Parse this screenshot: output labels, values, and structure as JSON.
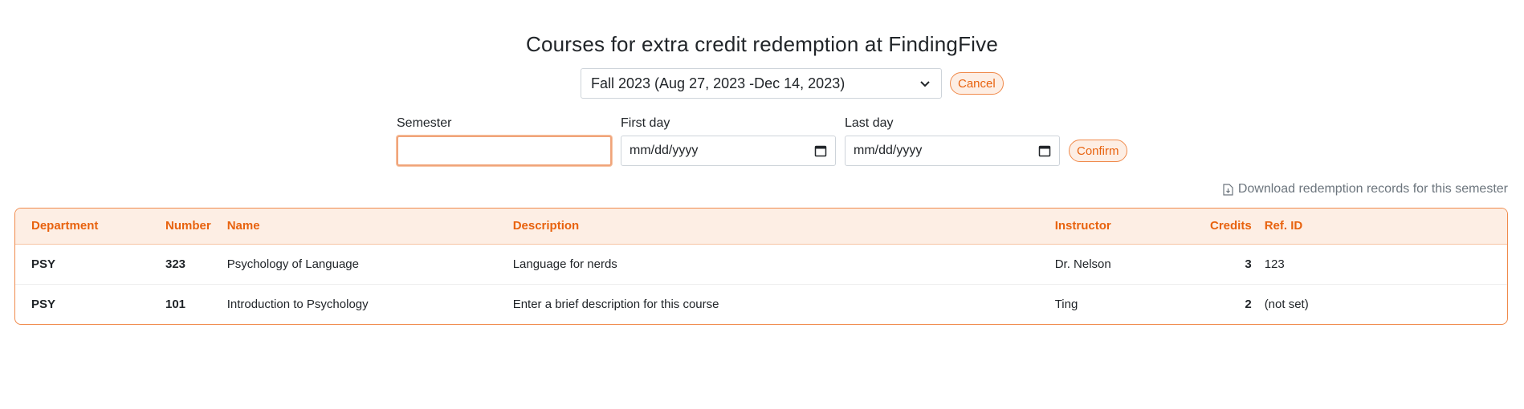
{
  "page": {
    "title": "Courses for extra credit redemption at FindingFive"
  },
  "semester_picker": {
    "selected": "Fall 2023 (Aug 27, 2023 -Dec 14, 2023)",
    "cancel_label": "Cancel"
  },
  "new_semester_form": {
    "semester_label": "Semester",
    "semester_value": "",
    "first_day_label": "First day",
    "first_day_placeholder": "mm/dd/yyyy",
    "last_day_label": "Last day",
    "last_day_placeholder": "mm/dd/yyyy",
    "confirm_label": "Confirm"
  },
  "download": {
    "label": "Download redemption records for this semester",
    "icon": "file-download-icon"
  },
  "courses_table": {
    "headers": {
      "department": "Department",
      "number": "Number",
      "name": "Name",
      "description": "Description",
      "instructor": "Instructor",
      "credits": "Credits",
      "ref_id": "Ref. ID"
    },
    "rows": [
      {
        "department": "PSY",
        "number": "323",
        "name": "Psychology of Language",
        "description": "Language for nerds",
        "instructor": "Dr. Nelson",
        "credits": "3",
        "ref_id": "123"
      },
      {
        "department": "PSY",
        "number": "101",
        "name": "Introduction to Psychology",
        "description": "Enter a brief description for this course",
        "instructor": "Ting",
        "credits": "2",
        "ref_id": "(not set)"
      }
    ]
  },
  "colors": {
    "accent": "#e8620e",
    "accent_border": "#f08a4b",
    "header_bg": "#fdeee4",
    "muted_text": "#6c757d"
  }
}
